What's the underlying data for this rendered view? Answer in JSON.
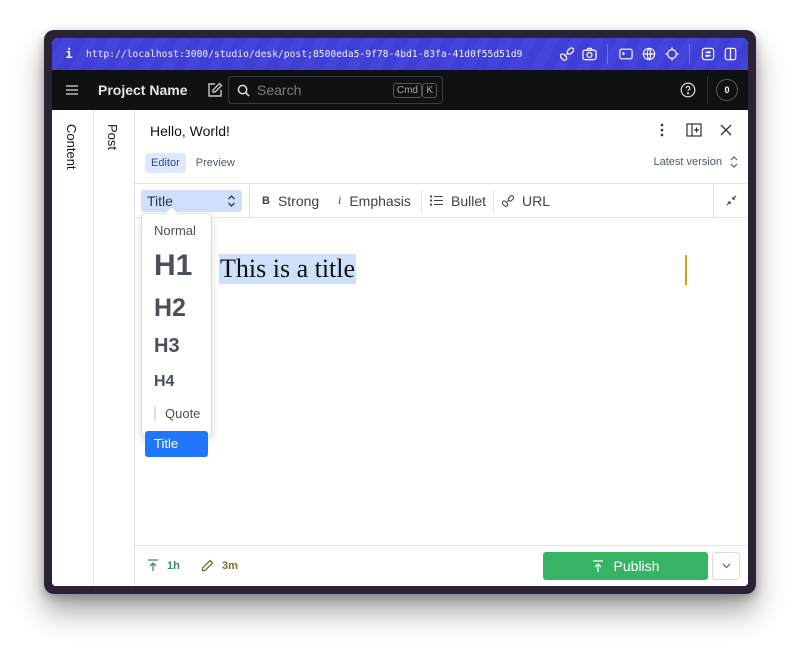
{
  "browser": {
    "info_label": "i",
    "url": "http://localhost:3000/studio/desk/post;8500eda5-9f78-4bd1-83fa-41d0f55d51d9",
    "tools": [
      "link-icon",
      "camera-icon",
      "terminal-icon",
      "globe-icon",
      "crosshair-icon",
      "settings-toggle-icon",
      "split-panel-icon"
    ]
  },
  "header": {
    "project_name": "Project Name",
    "search_placeholder": "Search",
    "shortcut_keys": [
      "Cmd",
      "K"
    ],
    "notification_count": "0"
  },
  "panes": {
    "content_label": "Content",
    "post_label": "Post"
  },
  "document": {
    "title": "Hello, World!",
    "tabs": [
      {
        "label": "Editor",
        "active": true
      },
      {
        "label": "Preview",
        "active": false
      }
    ],
    "version_label": "Latest version"
  },
  "toolbar": {
    "style_value": "Title",
    "items": [
      {
        "icon": "B",
        "label": "Strong"
      },
      {
        "icon": "i",
        "label": "Emphasis"
      },
      {
        "icon": "list",
        "label": "Bullet"
      },
      {
        "icon": "link",
        "label": "URL"
      }
    ]
  },
  "style_menu": {
    "options": [
      "Normal",
      "H1",
      "H2",
      "H3",
      "H4",
      "Quote",
      "Title"
    ],
    "selected": "Title"
  },
  "editor": {
    "content": "This is a title"
  },
  "footer": {
    "published_ago": "1h",
    "edited_ago": "3m",
    "publish_label": "Publish"
  },
  "colors": {
    "url_bar": "#3f3fd6",
    "app_header": "#101112",
    "accent_blue": "#2276fc",
    "selection": "#cfe0fb",
    "publish_green": "#36b365",
    "caret": "#d4a017"
  }
}
